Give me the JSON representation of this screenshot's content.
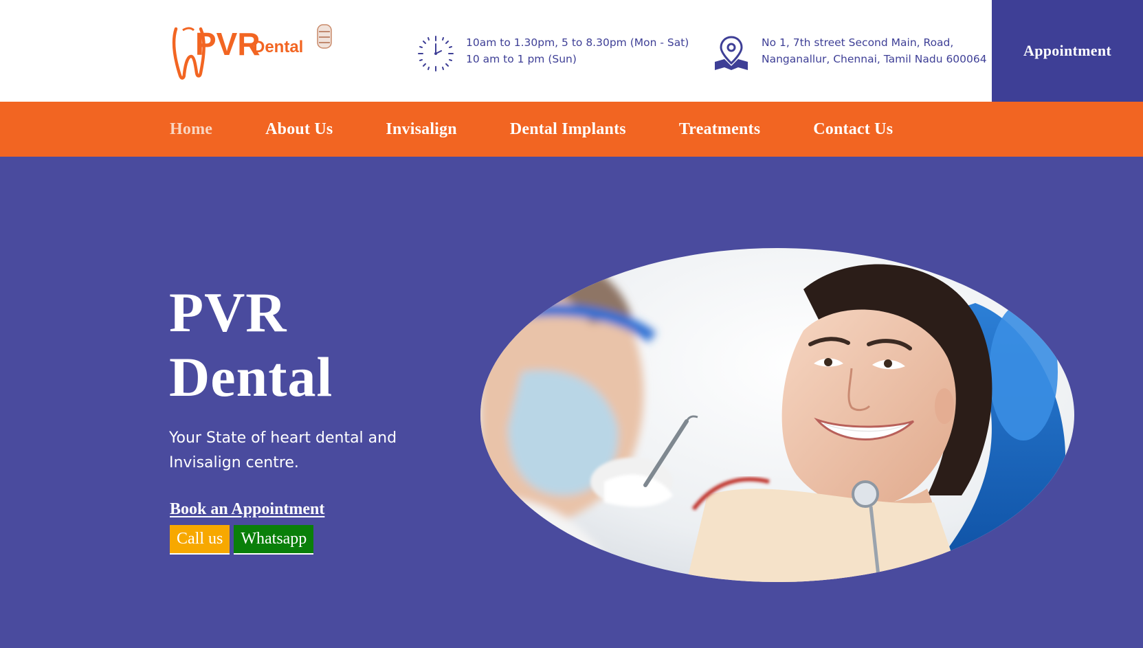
{
  "brand": {
    "name_part1": "PVR",
    "name_part2": "Dental",
    "orange": "#f26522",
    "purple": "#3e3f96"
  },
  "header": {
    "hours_line1": "10am to 1.30pm, 5 to 8.30pm (Mon - Sat)",
    "hours_line2": "10 am to 1 pm (Sun)",
    "address_line1": "No 1, 7th street Second Main, Road,",
    "address_line2": "Nanganallur, Chennai, Tamil Nadu 600064",
    "appointment_label": "Appointment",
    "hours_icon": "clock-icon",
    "address_icon": "map-pin-icon"
  },
  "nav": {
    "items": [
      {
        "label": "Home",
        "active": true
      },
      {
        "label": "About Us",
        "active": false
      },
      {
        "label": "Invisalign",
        "active": false
      },
      {
        "label": "Dental Implants",
        "active": false
      },
      {
        "label": "Treatments",
        "active": false
      },
      {
        "label": "Contact Us",
        "active": false
      }
    ]
  },
  "hero": {
    "title_line1": "PVR",
    "title_line2": "Dental",
    "subtitle": "Your State of heart dental and Invisalign centre.",
    "book_label": "Book an Appointment",
    "call_label": "Call us",
    "whatsapp_label": "Whatsapp",
    "call_color": "#f7a800",
    "whatsapp_color": "#0a7f0a",
    "background": "#4a4b9e"
  }
}
